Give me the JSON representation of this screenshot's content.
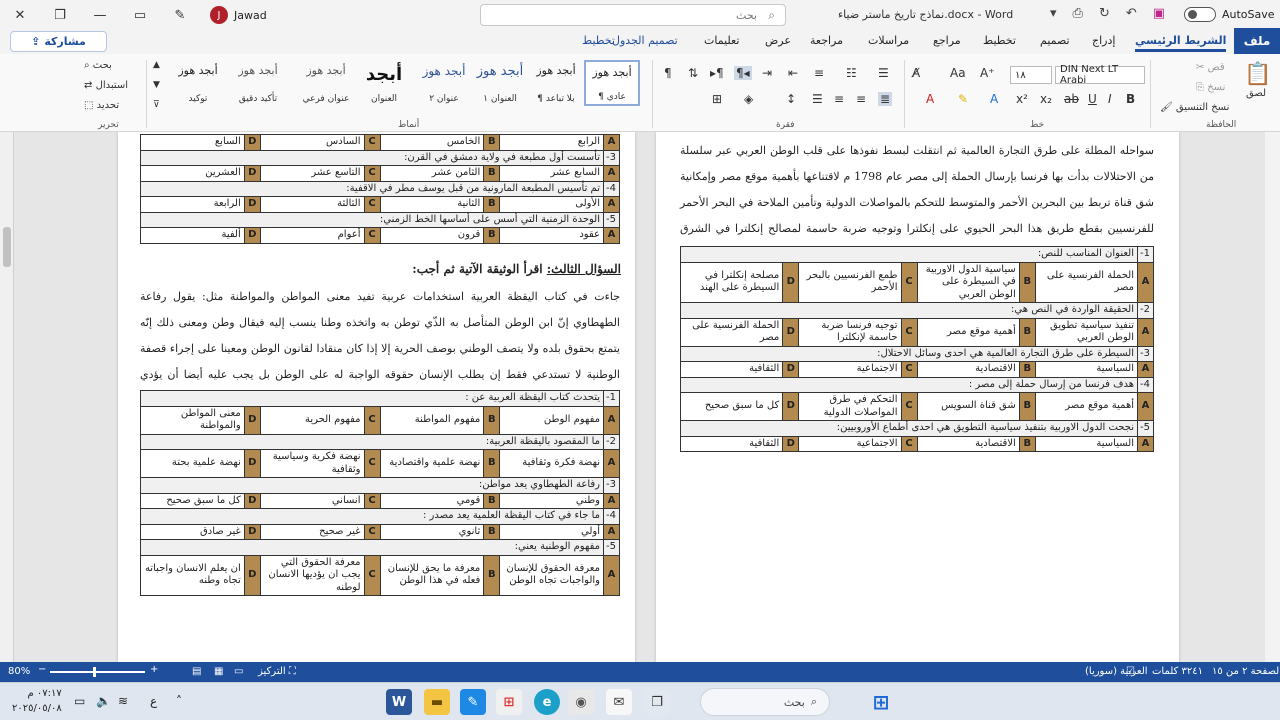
{
  "titlebar": {
    "user": "Jawad",
    "avatar_initial": "J",
    "search_placeholder": "بحث",
    "doc_name": "نماذج تاريخ ماستر ضياء.docx  -  Word",
    "autosave": "AutoSave"
  },
  "tabs": {
    "file": "ملف",
    "home": "الشريط الرئيسي",
    "insert": "إدراج",
    "design": "تصميم",
    "layout": "تخطيط",
    "references": "مراجع",
    "mailings": "مراسلات",
    "review": "مراجعة",
    "view": "عرض",
    "help": "تعليمات",
    "table_design": "تصميم الجدول",
    "table_layout": "تخطيط",
    "share": "مشاركة"
  },
  "ribbon": {
    "clipboard_label": "الحافظة",
    "paste": "لصق",
    "cut": "قص",
    "copy": "نسخ",
    "format_painter": "نسخ التنسيق",
    "font_label": "خط",
    "font_name": "DIN Next LT Arabi",
    "font_size": "١٨",
    "paragraph_label": "فقرة",
    "styles_label": "أنماط",
    "editing_label": "تحرير",
    "find": "بحث",
    "replace": "استبدال",
    "select": "تحديد",
    "styles": [
      {
        "sample": "أبجد هوز",
        "name": "¶ عادي"
      },
      {
        "sample": "أبجد هوز",
        "name": "¶ بلا تباعد"
      },
      {
        "sample": "أبجد هوز",
        "name": "العنوان ١"
      },
      {
        "sample": "أبجد هوز",
        "name": "عنوان ٢"
      },
      {
        "sample": "أبجد",
        "name": "العنوان"
      },
      {
        "sample": "أبجد هوز",
        "name": "عنوان فرعي"
      },
      {
        "sample": "أبجد هوز",
        "name": "تأكيد دقيق"
      },
      {
        "sample": "أبجد هوز",
        "name": "توكيد"
      }
    ]
  },
  "left_page": {
    "top_table": [
      {
        "type": "opts",
        "opts": [
          "الرابع",
          "الخامس",
          "السادس",
          "السابع"
        ]
      },
      {
        "type": "q",
        "num": "3-",
        "text": "تأسست أول مطبعة في ولاية دمشق في القرن:"
      },
      {
        "type": "opts",
        "opts": [
          "السابع عشر",
          "الثامن عشر",
          "التاسع عشر",
          "العشرين"
        ]
      },
      {
        "type": "q",
        "num": "4-",
        "text": "تم تأسيس المطبعة المارونية من قبل يوسف مطر في الاقفية:"
      },
      {
        "type": "opts",
        "opts": [
          "الأولى",
          "الثانية",
          "الثالثة",
          "الرابعة"
        ]
      },
      {
        "type": "q",
        "num": "5-",
        "text": "الوحدة الزمنية التي أسس على أساسها الخط الزمني:"
      },
      {
        "type": "opts",
        "opts": [
          "عقود",
          "قرون",
          "أعوام",
          "ألفية"
        ]
      }
    ],
    "section_title_prefix": "السؤال الثالث:",
    "section_title_rest": " اقرأ الوثيقة الآتية ثم أجب:",
    "paragraph": "جاءت في كتاب اليقظة العربية استخدامات عربية تفيد معنى المواطن والمواطنة مثل: يقول رفاعة الطهطاوي إنّ ابن الوطن المتأصل به الذّي توطن به واتخذه وطنا ينسب إليه فيقال وطن ومعنى ذلك إنّه يتمتع بحقوق بلده ولا يتصف الوطني بوصف الحرية إلا إذا كان منقادا لقانون الوطن ومعينا على إجراء قصفة الوطنية لا تستدعي فقط إن يطلب الإنسان حقوقه الواجبة له على الوطن بل يجب عليه أيضا أن يؤدي الحقوق التّي للوطن عليه.",
    "bottom_table": [
      {
        "type": "q",
        "num": "1-",
        "text": "يتحدث كتاب اليقظة العربية عن :"
      },
      {
        "type": "opts",
        "opts": [
          "مفهوم الوطن",
          "مفهوم المواطنة",
          "مفهوم الحرية",
          "معنى المواطن والمواطنة"
        ]
      },
      {
        "type": "q",
        "num": "2-",
        "text": "ما المقصود باليقظة العربية:"
      },
      {
        "type": "opts",
        "opts": [
          "نهضة فكرة وثقافية",
          "نهضة علمية واقتصادية",
          "نهضة فكرية وسياسية وثقافية",
          "نهضة علمية بحتة"
        ]
      },
      {
        "type": "q",
        "num": "3-",
        "text": "رفاعة الطهطاوي يعد مواطن:"
      },
      {
        "type": "opts",
        "opts": [
          "وطني",
          "قومي",
          "انساني",
          "كل ما سبق صحيح"
        ]
      },
      {
        "type": "q",
        "num": "4-",
        "text": "ما جاء في كتاب اليقظة العلمية يعد مصدر :"
      },
      {
        "type": "opts",
        "opts": [
          "أولي",
          "ثانوي",
          "غير صحيح",
          "غير صادق"
        ]
      },
      {
        "type": "q",
        "num": "5-",
        "text": "مفهوم الوطنية يعني:"
      },
      {
        "type": "opts",
        "opts": [
          "معرفة الحقوق للإنسان والواجبات تجاه الوطن",
          "معرفة ما يحق للإنسان فعله في هذا الوطن",
          "معرفة الحقوق التي يجب ان يؤديها الانسان لوطنه",
          "ان يعلم الانسان واجباته تجاه وطنه"
        ]
      }
    ]
  },
  "right_page": {
    "paragraph": "سواحله المطلة على طرق التجارة العالمية ثم انتقلت لبسط نفوذها على قلب الوطن العربي عبر سلسلة من الاحتلالات بدأت بها فرنسا بإرسال الحملة إلى مصر عام 1798 م لاقتناعها بأهمية موقع مصر وإمكانية شق قناة تربط بين البحرين الأحمر والمتوسط للتحكم بالمواصلات الدولية وتأمين الملاحة في البحر الأحمر للفرنسيين بقطع طريق هذا البحر الحيوي على إنكلترا وتوجيه ضربة حاسمة لمصالح إنكلترا في الشرق والهند.",
    "table": [
      {
        "type": "q",
        "num": "1-",
        "text": "العنوان المناسب للنص:"
      },
      {
        "type": "opts",
        "opts": [
          "الحملة الفرنسية على مصر",
          "سياسية الدول الاوربية في السيطرة على الوطن العربي",
          "طمع الفرنسيين بالبحر الأحمر",
          "مصلحة إنكلترا في السيطرة على الهند"
        ]
      },
      {
        "type": "q",
        "num": "2-",
        "text": "الحقيقة الواردة في النص هي:"
      },
      {
        "type": "opts",
        "opts": [
          "تنفيذ سياسية تطويق الوطن العربي",
          "أهمية موقع مصر",
          "توجيه فرنسا ضربة حاسمة لإنكلترا",
          "الحملة الفرنسية على مصر"
        ]
      },
      {
        "type": "q",
        "num": "3-",
        "text": "السيطرة على طرق التجارة العالمية هي احدى وسائل الاحتلال:"
      },
      {
        "type": "opts",
        "opts": [
          "السياسية",
          "الاقتصادية",
          "الاجتماعية",
          "الثقافية"
        ]
      },
      {
        "type": "q",
        "num": "4-",
        "text": "هدف فرنسا من إرسال حملة إلى مصر :"
      },
      {
        "type": "opts",
        "opts": [
          "أهمية موقع مصر",
          "شق قناة السويس",
          "التحكم في طرق المواصلات الدولية",
          "كل ما سبق صحيح"
        ]
      },
      {
        "type": "q",
        "num": "5-",
        "text": "نجحت الدول الاوربية بتنفيذ سياسية التطويق هي احدى أطماع الأوروبيين:"
      },
      {
        "type": "opts",
        "opts": [
          "السياسية",
          "الاقتصادية",
          "الاجتماعية",
          "الثقافية"
        ]
      }
    ]
  },
  "letters": [
    "A",
    "B",
    "C",
    "D"
  ],
  "statusbar": {
    "page": "الصفحة ٢ من ١٥",
    "words": "٣٢٤١ كلمات",
    "language": "العربية (سوريا)",
    "focus": "التركيز",
    "zoom": "80%"
  },
  "taskbar": {
    "search": "بحث",
    "time": "٠٧:١٧ م",
    "date": "٢٠٢٥/٠٥/٠٨",
    "lang_indicator": "ع"
  }
}
